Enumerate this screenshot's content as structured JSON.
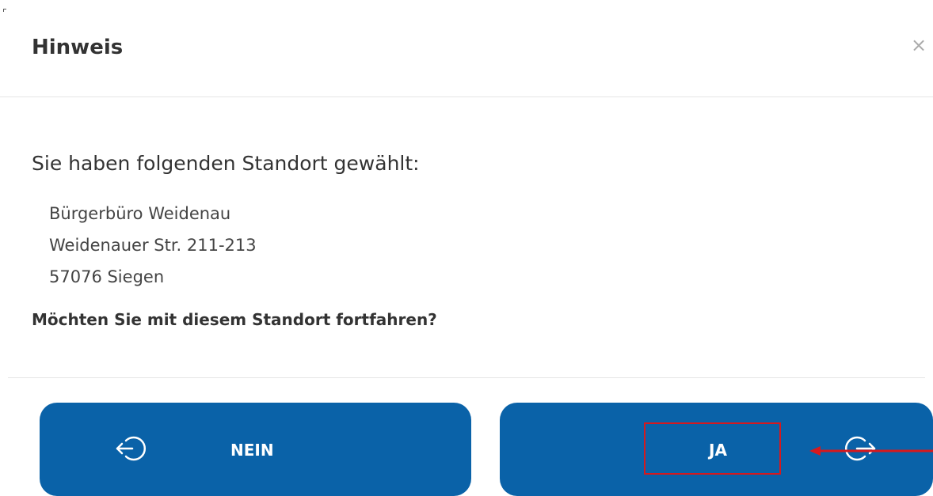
{
  "dialog": {
    "title": "Hinweis",
    "close_label": "×",
    "intro": "Sie haben folgenden Standort gewählt:",
    "address": {
      "name": "Bürgerbüro Weidenau",
      "street": "Weidenauer Str. 211-213",
      "city": "57076 Siegen"
    },
    "question": "Möchten Sie mit diesem Standort fortfahren?"
  },
  "buttons": {
    "no": {
      "label": "NEIN",
      "icon": "logout-icon"
    },
    "yes": {
      "label": "JA",
      "icon": "login-icon"
    }
  },
  "colors": {
    "button_bg": "#0a62a8",
    "annotation": "#d6191e",
    "title_text": "#333333",
    "divider": "#e5e5e5"
  }
}
